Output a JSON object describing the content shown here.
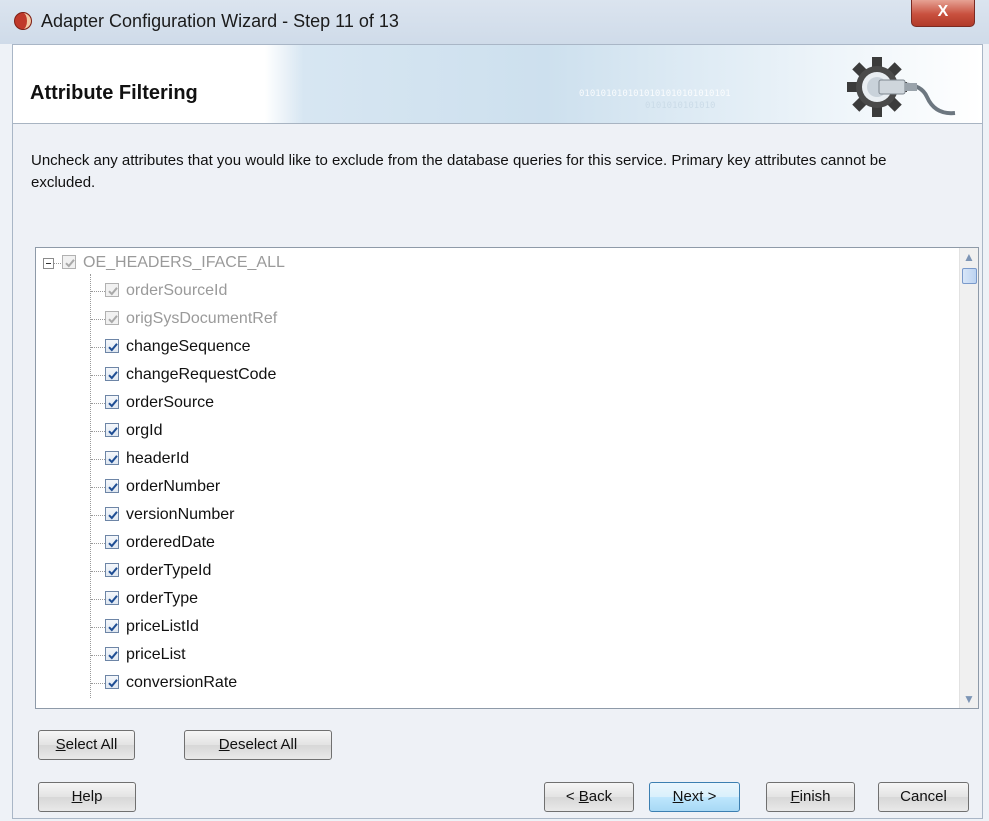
{
  "window": {
    "title": "Adapter Configuration Wizard - Step 11 of 13",
    "close_label": "X"
  },
  "header": {
    "title": "Attribute Filtering",
    "binary_text": "0101010101010101010101010101",
    "binary_text2": "0101010101010"
  },
  "description": "Uncheck any attributes that you would like to exclude from the database queries for this service.  Primary key attributes cannot be excluded.",
  "tree": {
    "root": {
      "label": "OE_HEADERS_IFACE_ALL",
      "checked": true,
      "disabled": true,
      "expanded": true
    },
    "items": [
      {
        "label": "orderSourceId",
        "checked": true,
        "disabled": true
      },
      {
        "label": "origSysDocumentRef",
        "checked": true,
        "disabled": true
      },
      {
        "label": "changeSequence",
        "checked": true,
        "disabled": false
      },
      {
        "label": "changeRequestCode",
        "checked": true,
        "disabled": false
      },
      {
        "label": "orderSource",
        "checked": true,
        "disabled": false
      },
      {
        "label": "orgId",
        "checked": true,
        "disabled": false
      },
      {
        "label": "headerId",
        "checked": true,
        "disabled": false
      },
      {
        "label": "orderNumber",
        "checked": true,
        "disabled": false
      },
      {
        "label": "versionNumber",
        "checked": true,
        "disabled": false
      },
      {
        "label": "orderedDate",
        "checked": true,
        "disabled": false
      },
      {
        "label": "orderTypeId",
        "checked": true,
        "disabled": false
      },
      {
        "label": "orderType",
        "checked": true,
        "disabled": false
      },
      {
        "label": "priceListId",
        "checked": true,
        "disabled": false
      },
      {
        "label": "priceList",
        "checked": true,
        "disabled": false
      },
      {
        "label": "conversionRate",
        "checked": true,
        "disabled": false
      }
    ]
  },
  "buttons": {
    "select_all": {
      "mnemonic": "S",
      "rest": "elect All"
    },
    "deselect_all": {
      "mnemonic": "D",
      "rest": "eselect All"
    },
    "help": {
      "mnemonic": "H",
      "rest": "elp"
    },
    "back": {
      "prefix": "< ",
      "mnemonic": "B",
      "rest": "ack"
    },
    "next": {
      "mnemonic": "N",
      "rest": "ext >"
    },
    "finish": {
      "mnemonic": "F",
      "rest": "inish"
    },
    "cancel": {
      "label": "Cancel"
    }
  },
  "colors": {
    "accent": "#3c7fb1",
    "checkmark": "#1f4e94",
    "disabled_text": "#9a9a9a"
  }
}
